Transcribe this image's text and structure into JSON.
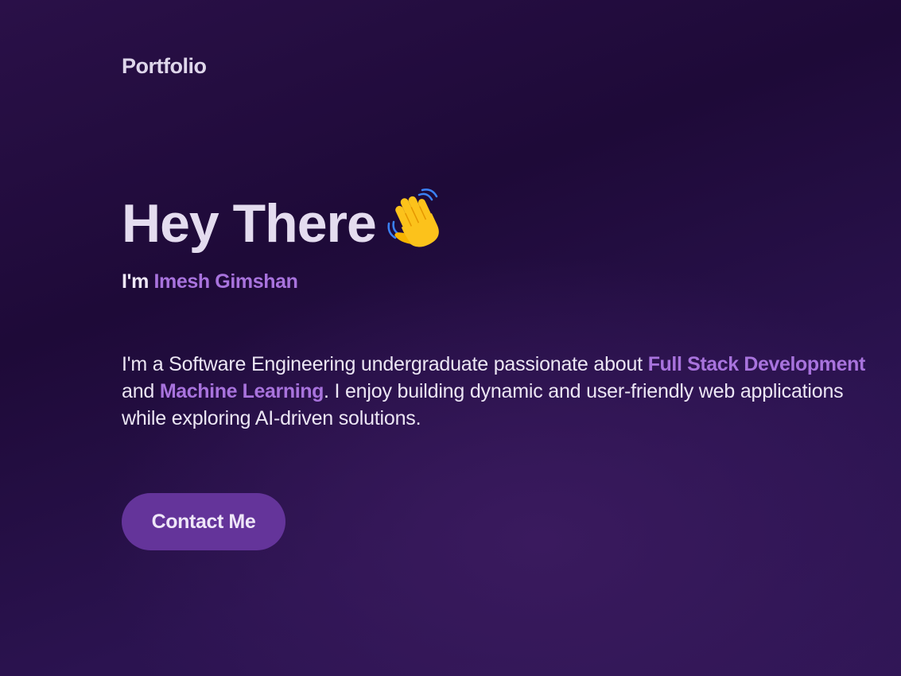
{
  "header": {
    "brand": "Portfolio"
  },
  "hero": {
    "greeting": "Hey There",
    "greeting_icon": "waving-hand-icon",
    "intro_prefix": "I'm",
    "name": "Imesh Gimshan",
    "bio": {
      "part1": "I'm a Software Engineering undergraduate passionate about ",
      "highlight1": "Full Stack Development",
      "part2": " and ",
      "highlight2": "Machine Learning",
      "part3": ". I enjoy building dynamic and user-friendly web applications while exploring AI-driven solutions."
    },
    "cta_label": "Contact Me"
  },
  "colors": {
    "accent": "#a873dd",
    "button_bg": "#64349a",
    "background_dark": "#1e0a38"
  }
}
